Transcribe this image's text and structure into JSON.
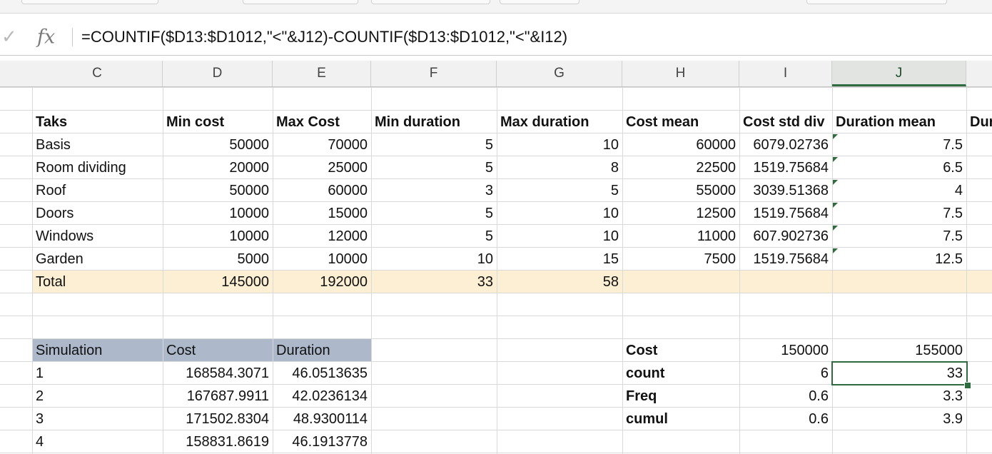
{
  "formula_bar": {
    "confirm_icon": "checkmark-icon",
    "fx_label": "fx",
    "formula": "=COUNTIF($D13:$D1012,\"<\"&J12)-COUNTIF($D13:$D1012,\"<\"&I12)"
  },
  "columns": [
    "C",
    "D",
    "E",
    "F",
    "G",
    "H",
    "I",
    "J"
  ],
  "selected_column": "J",
  "colors": {
    "total_band": "#fcefd4",
    "simulation_header": "#adb9ca",
    "selection": "#2e6b3f"
  },
  "tasks": {
    "headers": [
      "Taks",
      "Min cost",
      "Max Cost",
      "Min duration",
      "Max duration",
      "Cost mean",
      "Cost std div",
      "Duration mean",
      "Dur"
    ],
    "rows": [
      [
        "Basis",
        "50000",
        "70000",
        "5",
        "10",
        "60000",
        "6079.02736",
        "7.5"
      ],
      [
        "Room dividing",
        "20000",
        "25000",
        "5",
        "8",
        "22500",
        "1519.75684",
        "6.5"
      ],
      [
        "Roof",
        "50000",
        "60000",
        "3",
        "5",
        "55000",
        "3039.51368",
        "4"
      ],
      [
        "Doors",
        "10000",
        "15000",
        "5",
        "10",
        "12500",
        "1519.75684",
        "7.5"
      ],
      [
        "Windows",
        "10000",
        "12000",
        "5",
        "10",
        "11000",
        "607.902736",
        "7.5"
      ],
      [
        "Garden",
        "5000",
        "10000",
        "10",
        "15",
        "7500",
        "1519.75684",
        "12.5"
      ]
    ],
    "total": [
      "Total",
      "145000",
      "192000",
      "33",
      "58"
    ]
  },
  "simulation": {
    "headers": [
      "Simulation",
      "Cost",
      "Duration"
    ],
    "rows": [
      [
        "1",
        "168584.3071",
        "46.0513635"
      ],
      [
        "2",
        "167687.9911",
        "42.0236134"
      ],
      [
        "3",
        "171502.8304",
        "48.9300114"
      ],
      [
        "4",
        "158831.8619",
        "46.1913778"
      ]
    ]
  },
  "stats": {
    "rows": [
      [
        "Cost",
        "150000",
        "155000"
      ],
      [
        "count",
        "6",
        "33"
      ],
      [
        "Freq",
        "0.6",
        "3.3"
      ],
      [
        "cumul",
        "0.6",
        "3.9"
      ]
    ]
  }
}
